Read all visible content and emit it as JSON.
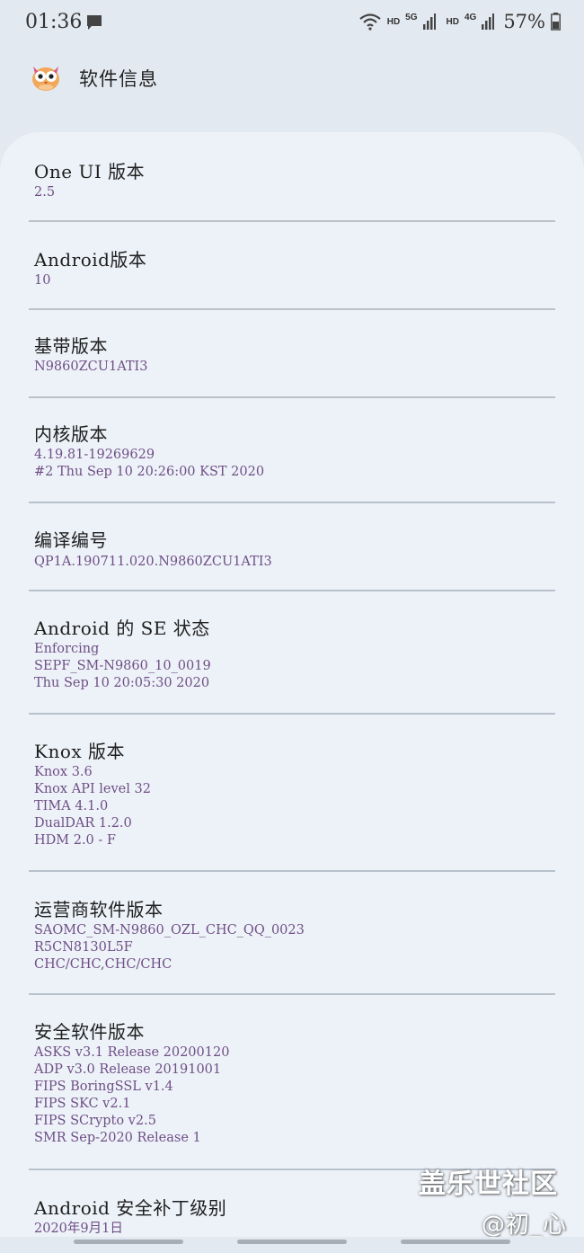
{
  "status_bar": {
    "time": "01:36",
    "signal_labels": [
      "HD",
      "5G",
      "HD",
      "4G"
    ],
    "battery": "57%",
    "icons": [
      "message-icon",
      "wifi-icon",
      "signal-icon",
      "battery-icon"
    ]
  },
  "header": {
    "title": "软件信息",
    "icon": "owl-app-icon"
  },
  "rows": [
    {
      "title": "One UI 版本",
      "lines": [
        "2.5"
      ]
    },
    {
      "title": "Android版本",
      "lines": [
        "10"
      ]
    },
    {
      "title": "基带版本",
      "lines": [
        "N9860ZCU1ATI3"
      ]
    },
    {
      "title": "内核版本",
      "lines": [
        "4.19.81-19269629",
        "#2 Thu Sep 10 20:26:00 KST 2020"
      ]
    },
    {
      "title": "编译编号",
      "lines": [
        "QP1A.190711.020.N9860ZCU1ATI3"
      ]
    },
    {
      "title": "Android 的 SE 状态",
      "lines": [
        "Enforcing",
        "SEPF_SM-N9860_10_0019",
        "Thu Sep 10 20:05:30 2020"
      ]
    },
    {
      "title": "Knox 版本",
      "lines": [
        "Knox 3.6",
        "Knox API level 32",
        "TIMA 4.1.0",
        "DualDAR 1.2.0",
        "HDM 2.0 - F"
      ]
    },
    {
      "title": "运营商软件版本",
      "lines": [
        "SAOMC_SM-N9860_OZL_CHC_QQ_0023",
        "R5CN8130L5F",
        "CHC/CHC,CHC/CHC"
      ]
    },
    {
      "title": "安全软件版本",
      "lines": [
        "ASKS v3.1 Release 20200120",
        "ADP v3.0 Release 20191001",
        "FIPS BoringSSL v1.4",
        "FIPS SKC v2.1",
        "FIPS SCrypto v2.5",
        "SMR Sep-2020 Release 1"
      ]
    },
    {
      "title": "Android 安全补丁级别",
      "lines": [
        "2020年9月1日"
      ]
    }
  ],
  "watermark": {
    "line1": "盖乐世社区",
    "line2": "@初_心"
  },
  "colors": {
    "background": "#e3e9f0",
    "card": "#edf2f8",
    "value_text": "#6f4f86",
    "divider": "#b8c1cc"
  }
}
